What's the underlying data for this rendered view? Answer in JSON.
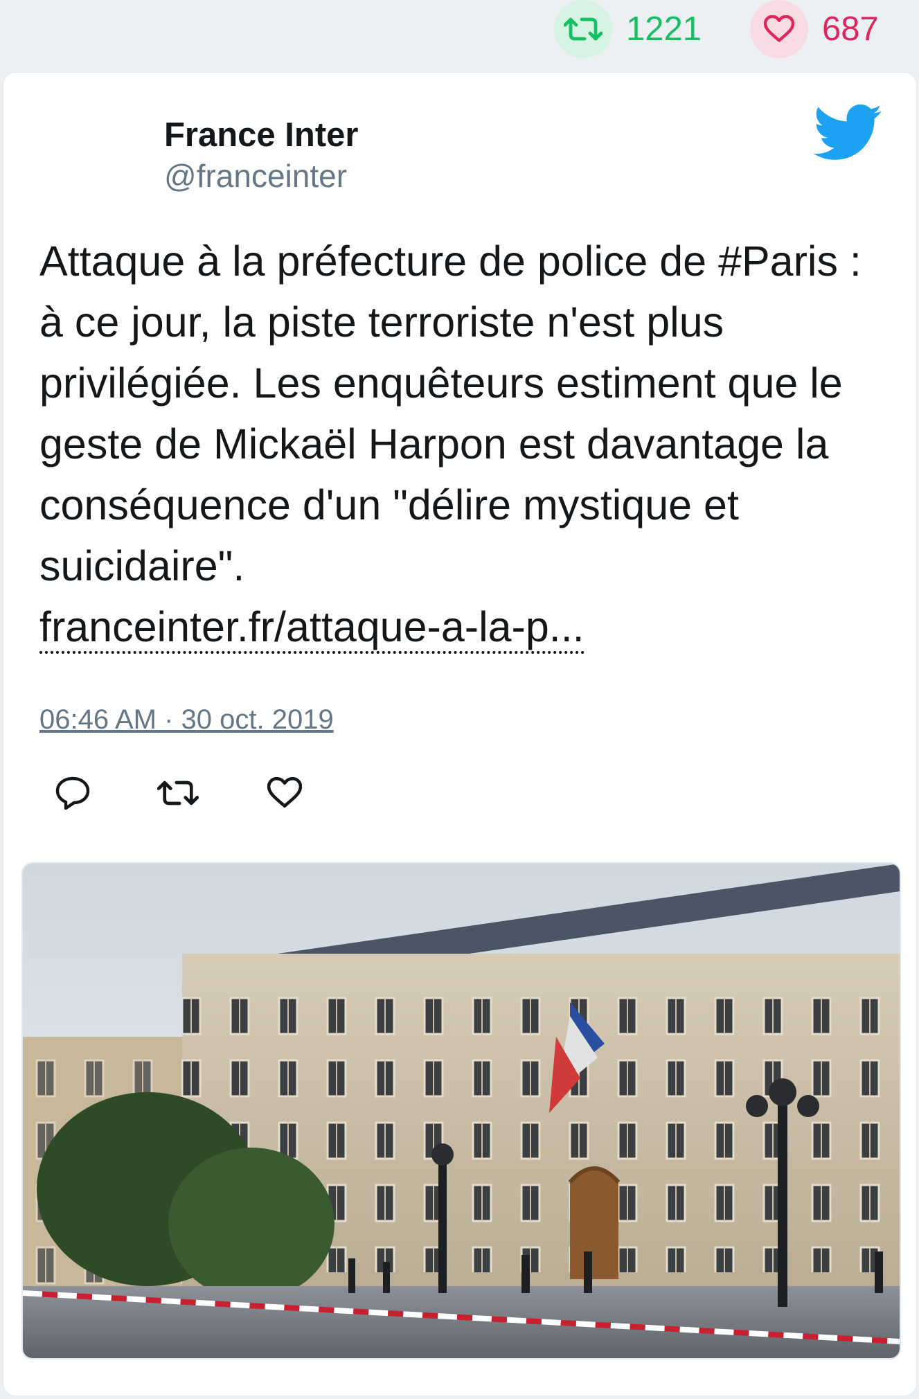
{
  "stats": {
    "retweets": "1221",
    "likes": "687",
    "retweet_color": "#17bf63",
    "like_color": "#e0245e"
  },
  "tweet": {
    "author_name": "France Inter",
    "author_handle": "@franceinter",
    "text": "Attaque à la préfecture de police de #Paris : à ce jour, la piste terroriste n'est plus privilégiée. Les enquêteurs estiment que le geste de Mickaël Harpon est davantage la conséquence d'un \"délire mystique et suicidaire\".",
    "link_text": "franceinter.fr/attaque-a-la-p...",
    "timestamp": "06:46 AM · 30 oct. 2019"
  },
  "icons": {
    "brand": "twitter-bird-icon",
    "actions": [
      "reply-icon",
      "retweet-icon",
      "like-icon"
    ]
  },
  "media": {
    "subject": "photo-building-facade"
  },
  "colors": {
    "twitter_blue": "#1da1f2",
    "text_primary": "#14171a",
    "text_secondary": "#657786"
  }
}
